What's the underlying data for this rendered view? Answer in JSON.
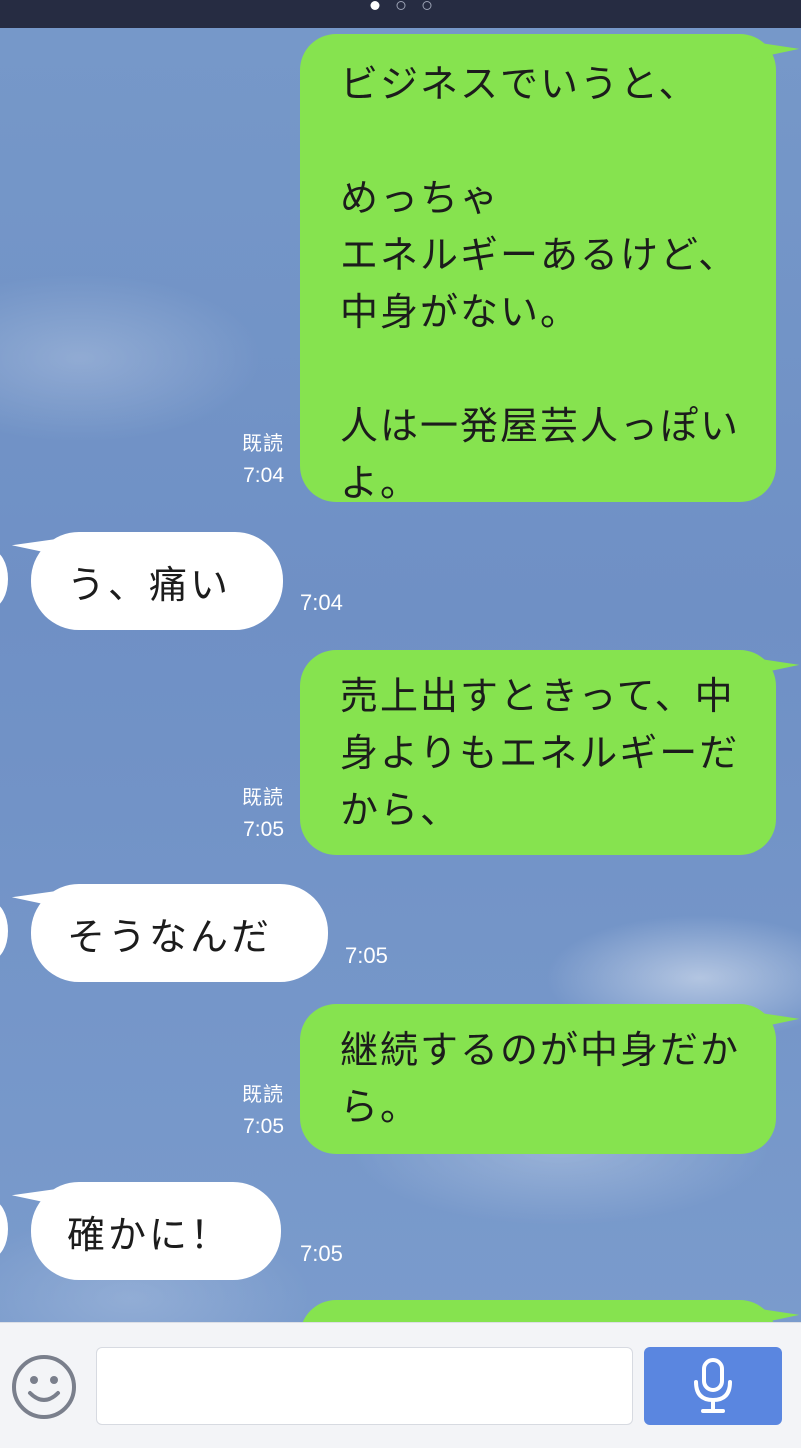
{
  "pager": {
    "total": 3,
    "active_index": 0
  },
  "messages": [
    {
      "type": "outgoing",
      "text": "ビジネスでいうと、\n\nめっちゃ\nエネルギーあるけど、中身がない。\n\n人は一発屋芸人っぽいよ。",
      "read_label": "既読",
      "time": "7:04"
    },
    {
      "type": "incoming",
      "text": "う、痛い",
      "time": "7:04"
    },
    {
      "type": "outgoing",
      "text": "売上出すときって、中身よりもエネルギーだから、",
      "read_label": "既読",
      "time": "7:05"
    },
    {
      "type": "incoming",
      "text": "そうなんだ",
      "time": "7:05"
    },
    {
      "type": "outgoing",
      "text": "継続するのが中身だから。",
      "read_label": "既読",
      "time": "7:05"
    },
    {
      "type": "incoming",
      "text": "確かに！",
      "time": "7:05"
    }
  ],
  "input": {
    "placeholder": "",
    "value": ""
  },
  "icons": {
    "emoji": "smiley-face-icon",
    "send": "microphone-icon"
  },
  "colors": {
    "outgoing_bubble": "#86e34f",
    "incoming_bubble": "#ffffff",
    "chat_background": "#7595c7",
    "top_bar": "#262c42",
    "mic_button": "#5a86e0"
  }
}
